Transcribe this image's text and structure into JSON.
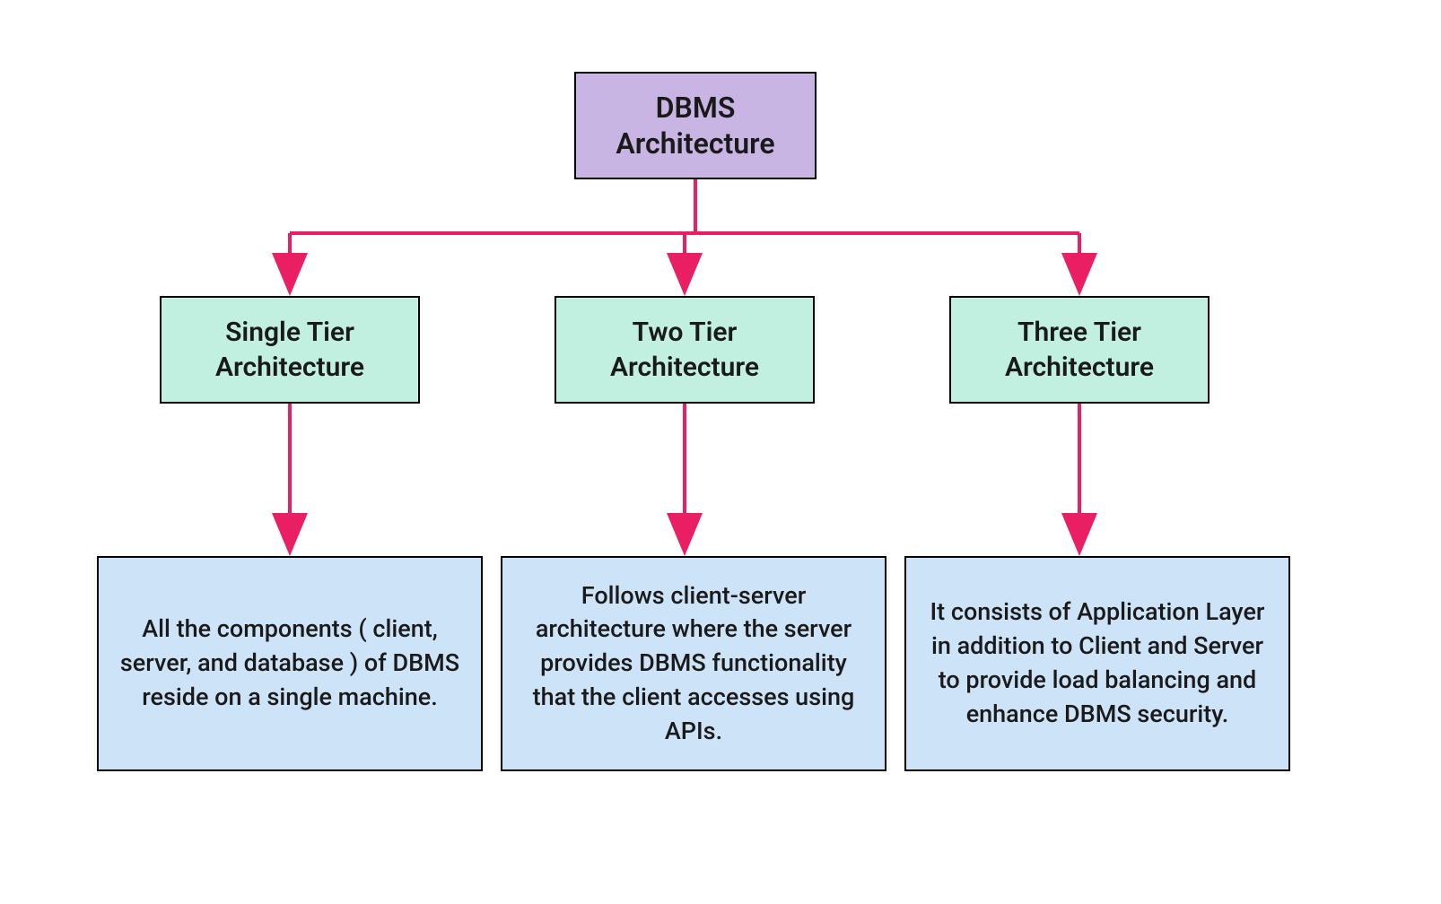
{
  "root": {
    "title": "DBMS Architecture"
  },
  "tiers": [
    {
      "title": "Single Tier Architecture",
      "description": "All the components ( client, server, and database ) of DBMS reside on a single machine."
    },
    {
      "title": "Two Tier Architecture",
      "description": "Follows client-server architecture where the server provides DBMS functionality that the client accesses using APIs."
    },
    {
      "title": "Three Tier Architecture",
      "description": "It consists of Application Layer in addition to Client and Server to provide load balancing and enhance DBMS security."
    }
  ],
  "colors": {
    "root_bg": "#c8b5e3",
    "tier_bg": "#c1f0e0",
    "desc_bg": "#cde3f8",
    "arrow": "#e91e63",
    "border": "#000000"
  }
}
